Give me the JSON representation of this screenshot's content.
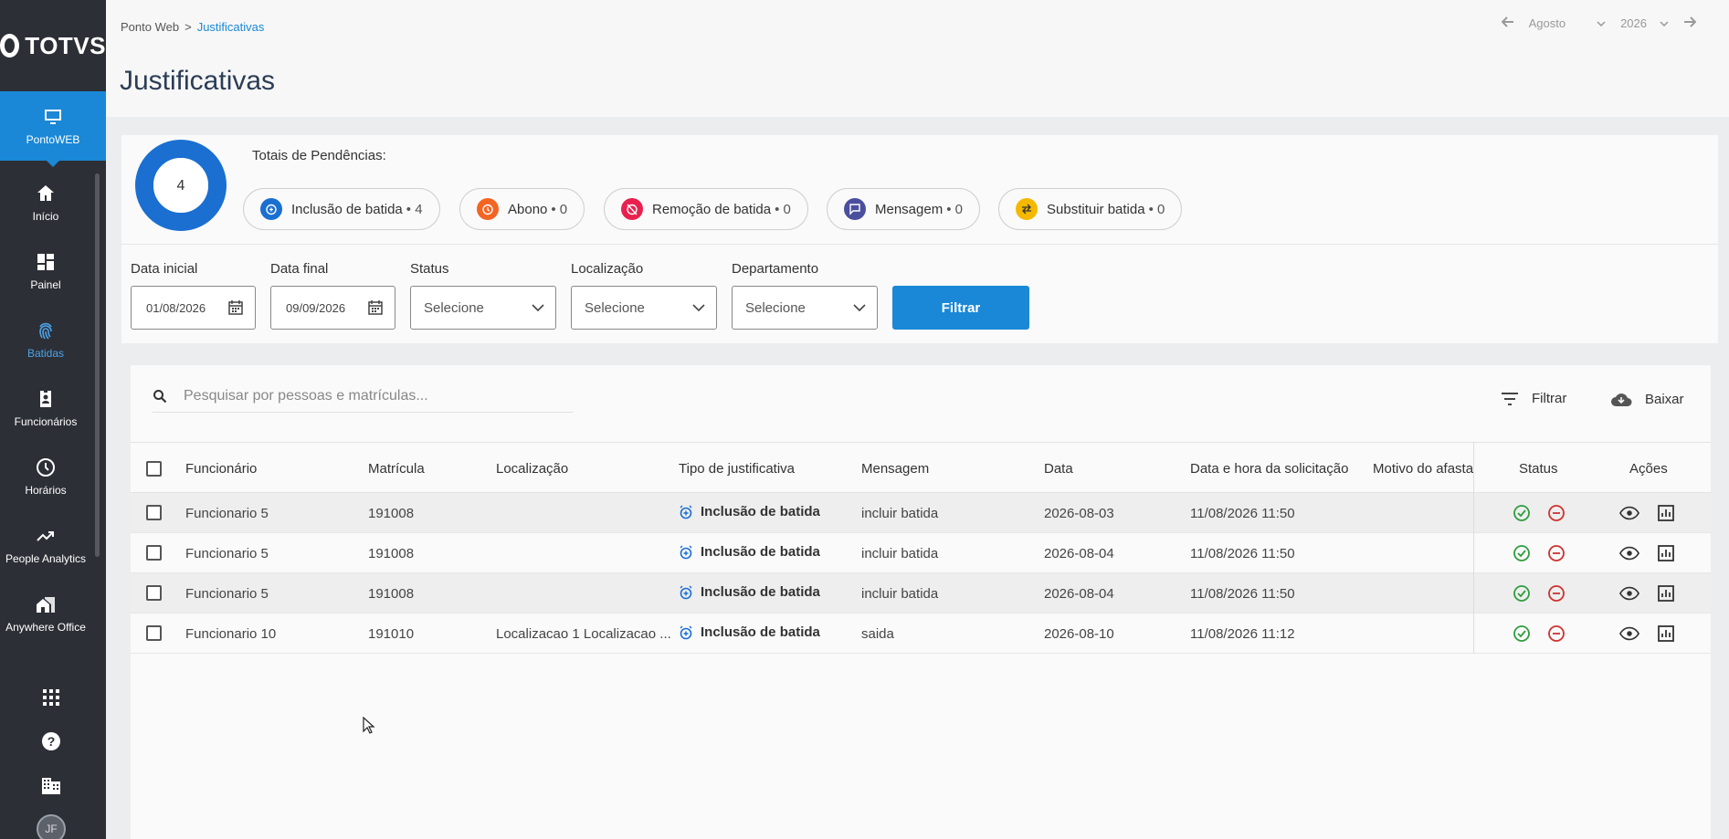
{
  "app": {
    "logo_text": "TOTVS"
  },
  "sidebar": {
    "active": {
      "label": "PontoWEB",
      "icon": "monitor-icon"
    },
    "items": [
      {
        "label": "Início",
        "icon": "home-icon"
      },
      {
        "label": "Painel",
        "icon": "dashboard-icon"
      },
      {
        "label": "Batidas",
        "icon": "fingerprint-icon"
      },
      {
        "label": "Funcionários",
        "icon": "badge-icon"
      },
      {
        "label": "Horários",
        "icon": "clock-icon"
      },
      {
        "label": "People Analytics",
        "icon": "trending-up-icon"
      },
      {
        "label": "Anywhere Office",
        "icon": "home-work-icon"
      }
    ],
    "avatar": "JF"
  },
  "header": {
    "breadcrumb": {
      "root": "Ponto Web",
      "separator": ">",
      "current": "Justificativas"
    },
    "title": "Justificativas",
    "month": "Agosto",
    "year": "2026"
  },
  "summary": {
    "label": "Totais de Pendências:",
    "total": "4",
    "chips": [
      {
        "label": "Inclusão de batida",
        "count": "4",
        "color": "#1a6fd1"
      },
      {
        "label": "Abono",
        "count": "0",
        "color": "#f26522"
      },
      {
        "label": "Remoção de batida",
        "count": "0",
        "color": "#e8214e"
      },
      {
        "label": "Mensagem",
        "count": "0",
        "color": "#4a4f9e"
      },
      {
        "label": "Substituir batida",
        "count": "0",
        "color": "#f5b800"
      }
    ]
  },
  "filters": {
    "data_inicial_label": "Data inicial",
    "data_inicial": "01/08/2026",
    "data_final_label": "Data final",
    "data_final": "09/09/2026",
    "status_label": "Status",
    "status": "Selecione",
    "localizacao_label": "Localização",
    "localizacao": "Selecione",
    "departamento_label": "Departamento",
    "departamento": "Selecione",
    "button": "Filtrar"
  },
  "table": {
    "search_placeholder": "Pesquisar por pessoas e matrículas...",
    "filter_label": "Filtrar",
    "download_label": "Baixar",
    "columns": [
      "Funcionário",
      "Matrícula",
      "Localização",
      "Tipo de justificativa",
      "Mensagem",
      "Data",
      "Data e hora da solicitação",
      "Motivo do afasta",
      "Status",
      "Ações"
    ],
    "rows": [
      {
        "funcionario": "Funcionario 5",
        "matricula": "191008",
        "localizacao": "",
        "tipo": "Inclusão de batida",
        "mensagem": "incluir batida",
        "data": "2026-08-03",
        "solicitacao": "11/08/2026 11:50"
      },
      {
        "funcionario": "Funcionario 5",
        "matricula": "191008",
        "localizacao": "",
        "tipo": "Inclusão de batida",
        "mensagem": "incluir batida",
        "data": "2026-08-04",
        "solicitacao": "11/08/2026 11:50"
      },
      {
        "funcionario": "Funcionario 5",
        "matricula": "191008",
        "localizacao": "",
        "tipo": "Inclusão de batida",
        "mensagem": "incluir batida",
        "data": "2026-08-04",
        "solicitacao": "11/08/2026 11:50"
      },
      {
        "funcionario": "Funcionario 10",
        "matricula": "191010",
        "localizacao": "Localizacao 1 Localizacao ...",
        "tipo": "Inclusão de batida",
        "mensagem": "saida",
        "data": "2026-08-10",
        "solicitacao": "11/08/2026 11:12"
      }
    ]
  },
  "colors": {
    "accent": "#1a88d6",
    "sidebar": "#2c2f36",
    "approve": "#2e9e3e",
    "reject": "#d0312d"
  }
}
